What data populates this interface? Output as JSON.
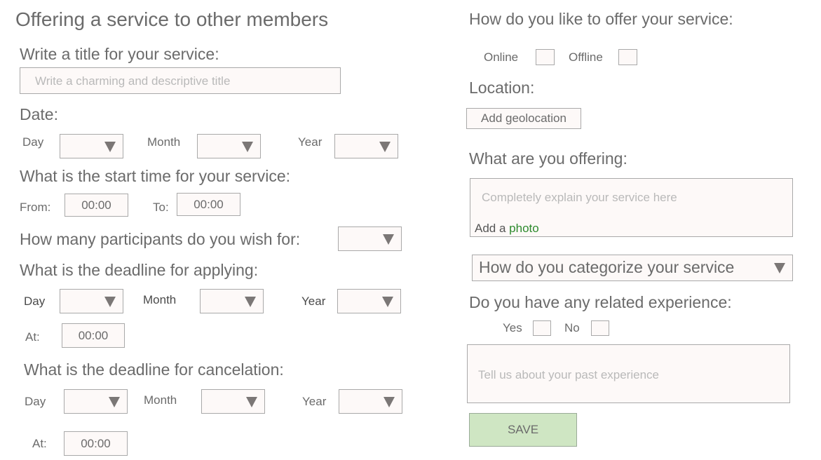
{
  "title": "Offering a service to other members",
  "left": {
    "title_label": "Write a title for your service:",
    "title_placeholder": "Write a charming and descriptive title",
    "date_label": "Date:",
    "day": "Day",
    "month": "Month",
    "year": "Year",
    "start_label": "What is the start time for your service:",
    "from": "From:",
    "from_value": "00:00",
    "to": "To:",
    "to_value": "00:00",
    "participants_label": "How many participants do you wish for:",
    "apply_label": "What is the deadline for applying:",
    "at": "At:",
    "apply_at_value": "00:00",
    "cancel_label": "What is the deadline for cancelation:",
    "cancel_at_value": "00:00"
  },
  "right": {
    "offer_label": "How do you like to offer your service:",
    "online": "Online",
    "offline": "Offline",
    "location_label": "Location:",
    "geolocation_button": "Add geolocation",
    "offering_label": "What are you offering:",
    "offering_placeholder": "Completely explain your service here",
    "add_a": "Add a",
    "photo_link": "photo",
    "category_select": "How do you categorize your service",
    "experience_label": "Do you have any related experience:",
    "yes": "Yes",
    "no": "No",
    "experience_placeholder": "Tell us about your past experience",
    "save": "SAVE"
  },
  "colors": {
    "link": "#2e8b2e",
    "save_bg": "#cfe6c3"
  }
}
